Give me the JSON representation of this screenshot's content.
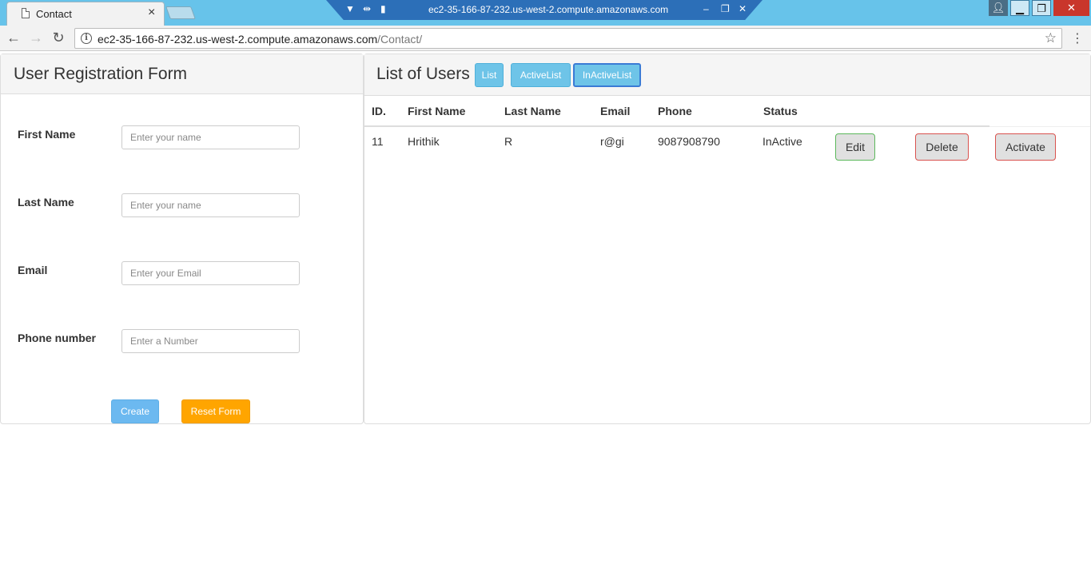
{
  "browser": {
    "tab_title": "Contact",
    "tab_close": "×",
    "remote_title": "ec2-35-166-87-232.us-west-2.compute.amazonaws.com",
    "url_host": "ec2-35-166-87-232.us-west-2.compute.amazonaws.com",
    "url_path": "/Contact/",
    "icons": [
      "document-icon",
      "back-arrow-icon",
      "forward-arrow-icon",
      "reload-icon",
      "info-icon",
      "star-icon",
      "menu-icon"
    ]
  },
  "form": {
    "title": "User Registration Form",
    "fields": [
      {
        "label": "First Name",
        "placeholder": "Enter your name"
      },
      {
        "label": "Last Name",
        "placeholder": "Enter your name"
      },
      {
        "label": "Email",
        "placeholder": "Enter your Email"
      },
      {
        "label": "Phone number",
        "placeholder": "Enter a Number"
      }
    ],
    "create_label": "Create",
    "reset_label": "Reset Form"
  },
  "users": {
    "title": "List of Users",
    "filter_buttons": [
      "List",
      "ActiveList",
      "InActiveList"
    ],
    "columns": [
      "ID.",
      "First Name",
      "Last Name",
      "Email",
      "Phone",
      "Status"
    ],
    "rows": [
      {
        "id": "11",
        "first": "Hrithik",
        "last": "R",
        "email": "r@gi",
        "phone": "9087908790",
        "status": "InActive",
        "actions": [
          "Edit",
          "Delete",
          "Activate"
        ]
      }
    ]
  },
  "colors": {
    "create": "#6cb9f0",
    "reset": "#ffa500",
    "filter": "#6ec4e8",
    "titlebar": "#67c3ea"
  }
}
